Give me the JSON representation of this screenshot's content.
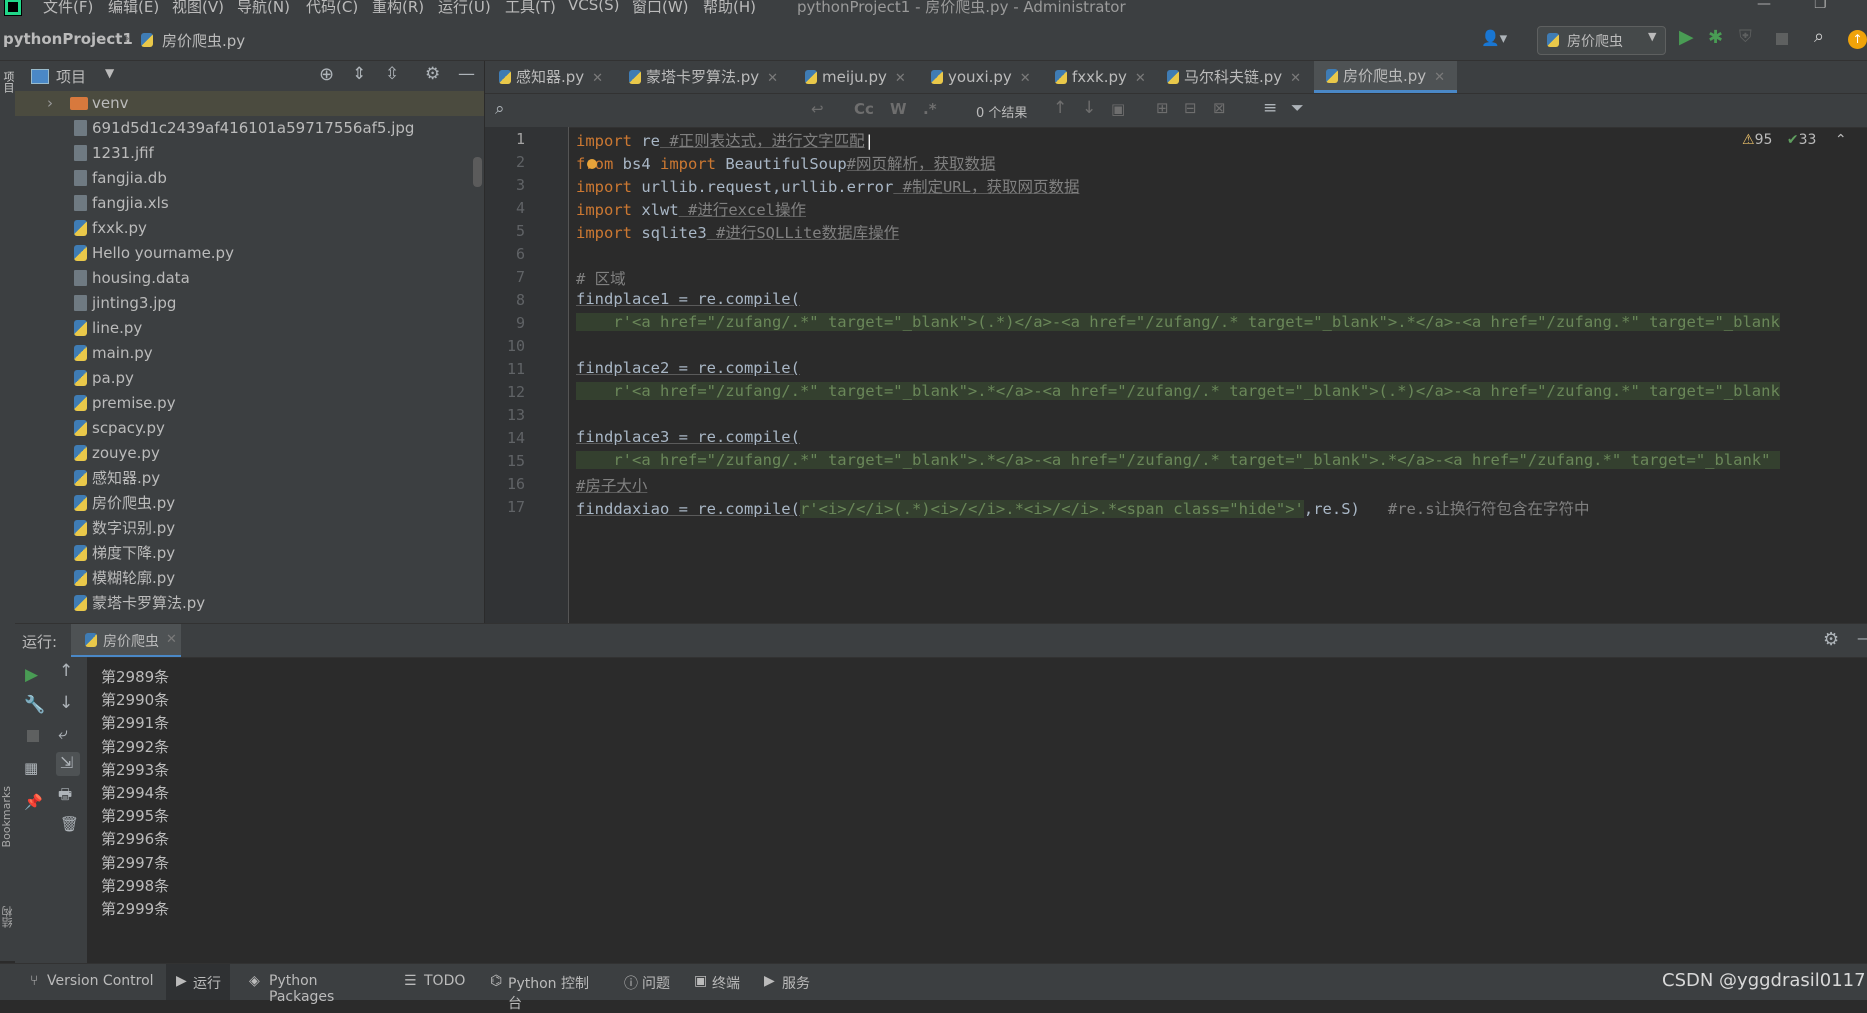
{
  "menu": [
    "文件(F)",
    "编辑(E)",
    "视图(V)",
    "导航(N)",
    "代码(C)",
    "重构(R)",
    "运行(U)",
    "工具(T)",
    "VCS(S)",
    "窗口(W)",
    "帮助(H)"
  ],
  "window_title": "pythonProject1 - 房价爬虫.py - Administrator",
  "breadcrumb": {
    "project": "pythonProject1",
    "file": "房价爬虫.py"
  },
  "run_config": "房价爬虫",
  "sidebar_left_label": "项目",
  "bookmarks_label": "Bookmarks",
  "structure_label": "结构",
  "project_panel": {
    "title": "项目",
    "folder": "venv",
    "files": [
      "691d5d1c2439af416101a59717556af5.jpg",
      "1231.jfif",
      "fangjia.db",
      "fangjia.xls",
      "fxxk.py",
      "Hello yourname.py",
      "housing.data",
      "jinting3.jpg",
      "line.py",
      "main.py",
      "pa.py",
      "premise.py",
      "scpacy.py",
      "zouye.py",
      "感知器.py",
      "房价爬虫.py",
      "数字识别.py",
      "梯度下降.py",
      "模糊轮廓.py",
      "蒙塔卡罗算法.py"
    ]
  },
  "editor_tabs": [
    "感知器.py",
    "蒙塔卡罗算法.py",
    "meiju.py",
    "youxi.py",
    "fxxk.py",
    "马尔科夫链.py",
    "房价爬虫.py"
  ],
  "active_tab": "房价爬虫.py",
  "search": {
    "results": "0 个结果",
    "cc": "Cc",
    "w": "W",
    "regex": ".*"
  },
  "inspections": {
    "warnings": "95",
    "ok": "33"
  },
  "code_lines": [
    "1",
    "2",
    "3",
    "4",
    "5",
    "6",
    "7",
    "8",
    "9",
    "10",
    "11",
    "12",
    "13",
    "14",
    "15",
    "16",
    "17"
  ],
  "code": {
    "l1_kw": "import",
    "l1_rest": " re",
    "l1_cm": " #正则表达式，进行文字匹配",
    "l2_kw1": "from",
    "l2_a": " bs4 ",
    "l2_kw2": "import",
    "l2_b": " BeautifulSoup",
    "l2_cm": "#网页解析，获取数据",
    "l3_kw": "import",
    "l3_rest": " urllib.request,urllib.error",
    "l3_cm": " #制定URL，获取网页数据",
    "l4_kw": "import",
    "l4_rest": " xlwt",
    "l4_cm": " #进行excel操作",
    "l5_kw": "import",
    "l5_rest": " sqlite3",
    "l5_cm": " #进行SQLLite数据库操作",
    "l7_cm": "# 区域",
    "l8": "findplace1 = re.compile(",
    "l9": "    r'<a href=\"/zufang/.*\" target=\"_blank\">(.*)</a>-<a href=\"/zufang/.* target=\"_blank\">.*</a>-<a href=\"/zufang.*\" target=\"_blank",
    "l11": "findplace2 = re.compile(",
    "l12": "    r'<a href=\"/zufang/.*\" target=\"_blank\">.*</a>-<a href=\"/zufang/.* target=\"_blank\">(.*)</a>-<a href=\"/zufang.*\" target=\"_blank",
    "l14": "findplace3 = re.compile(",
    "l15": "    r'<a href=\"/zufang/.*\" target=\"_blank\">.*</a>-<a href=\"/zufang/.* target=\"_blank\">.*</a>-<a href=\"/zufang.*\" target=\"_blank\" ",
    "l16_cm": "#房子大小",
    "l17_a": "finddaxiao = re.compile(",
    "l17_str": "r'<i>/</i>(.*)<i>/</i>.*<i>/</i>.*<span class=\"hide\">'",
    "l17_b": ",re.S)",
    "l17_cm": "   #re.s让换行符包含在字符中"
  },
  "run_panel": {
    "label": "运行:",
    "tab": "房价爬虫",
    "output": [
      "第2989条",
      "第2990条",
      "第2991条",
      "第2992条",
      "第2993条",
      "第2994条",
      "第2995条",
      "第2996条",
      "第2997条",
      "第2998条",
      "第2999条"
    ]
  },
  "status_tabs": [
    "Version Control",
    "运行",
    "Python Packages",
    "TODO",
    "Python 控制台",
    "问题",
    "终端",
    "服务"
  ],
  "watermark": "CSDN @yggdrasil0117"
}
